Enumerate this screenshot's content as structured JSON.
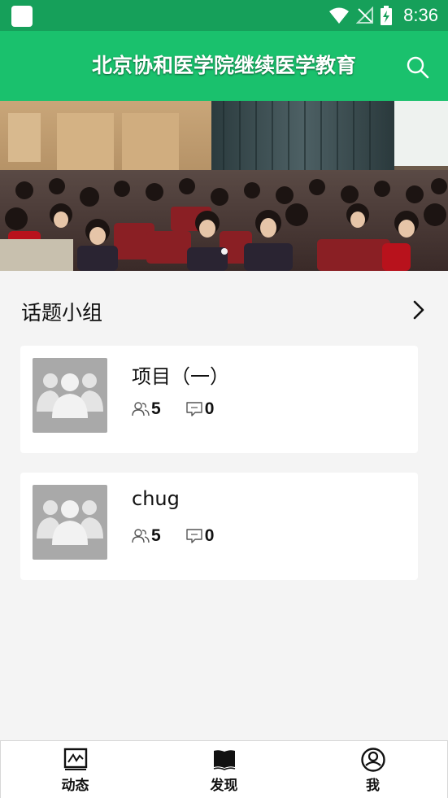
{
  "status_bar": {
    "time": "8:36",
    "icons": [
      "app-notification-icon",
      "wifi-icon",
      "no-signal-icon",
      "battery-charging-icon"
    ]
  },
  "header": {
    "title": "北京协和医学院继续医学教育",
    "search_icon": "search-icon"
  },
  "banner": {
    "image": "lecture-hall-photo",
    "dot_count": 1
  },
  "section": {
    "title": "话题小组",
    "more_icon": "chevron-right-icon"
  },
  "groups": [
    {
      "name": "项目（一）",
      "members": "5",
      "comments": "0"
    },
    {
      "name": "chug",
      "members": "5",
      "comments": "0"
    }
  ],
  "bottom_nav": [
    {
      "label": "动态",
      "icon": "activity-icon"
    },
    {
      "label": "发现",
      "icon": "book-icon"
    },
    {
      "label": "我",
      "icon": "profile-icon"
    }
  ],
  "colors": {
    "status_bar": "#16a05a",
    "app_bar": "#1ac16d",
    "avatar_bg": "#a9a9a9",
    "page_bg": "#f4f4f4"
  }
}
